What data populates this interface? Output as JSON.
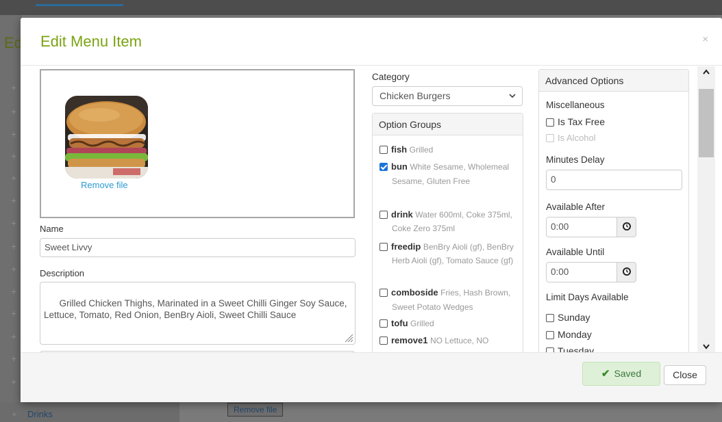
{
  "background": {
    "heading_fragment": "Ed",
    "sidebar_last_item": "Drinks",
    "remove_file_label": "Remove file"
  },
  "modal": {
    "title": "Edit Menu Item",
    "close_icon": "×",
    "image": {
      "alt": "Sweet Livvy burger photo",
      "remove_label": "Remove file"
    },
    "name_label": "Name",
    "name_value": "Sweet Livvy",
    "description_label": "Description",
    "description_value": "Grilled Chicken Thighs, Marinated in a Sweet Chilli Ginger Soy Sauce, Lettuce, Tomato, Red Onion, BenBry Aioli, Sweet Chilli Sauce",
    "category_label": "Category",
    "category_value": "Chicken Burgers",
    "option_groups": {
      "heading": "Option Groups",
      "items": [
        {
          "name": "fish",
          "details": "Grilled",
          "checked": false
        },
        {
          "name": "bun",
          "details": "White Sesame, Wholemeal Sesame, Gluten Free",
          "checked": true
        },
        {
          "name": "drink",
          "details": "Water 600ml, Coke 375ml, Coke Zero 375ml",
          "checked": false
        },
        {
          "name": "freedip",
          "details": "BenBry Aioli (gf), BenBry Herb Aioli (gf), Tomato Sauce (gf)",
          "checked": false
        },
        {
          "name": "comboside",
          "details": "Fries, Hash Brown, Sweet Potato Wedges",
          "checked": false
        },
        {
          "name": "tofu",
          "details": "Grilled",
          "checked": false
        },
        {
          "name": "remove1",
          "details": "NO Lettuce, NO",
          "checked": false
        }
      ]
    },
    "advanced": {
      "heading": "Advanced Options",
      "misc_label": "Miscellaneous",
      "tax_free_label": "Is Tax Free",
      "alcohol_label": "Is Alcohol",
      "minutes_delay_label": "Minutes Delay",
      "minutes_delay_value": "0",
      "available_after_label": "Available After",
      "available_after_value": "0:00",
      "available_until_label": "Available Until",
      "available_until_value": "0:00",
      "limit_days_label": "Limit Days Available",
      "days": [
        "Sunday",
        "Monday",
        "Tuesday"
      ]
    },
    "footer": {
      "saved_label": "Saved",
      "close_label": "Close"
    }
  },
  "colors": {
    "title": "#7aa311",
    "link": "#2a9bd0",
    "checkbox_checked": "#1a73d9",
    "saved_bg": "#dff0d8",
    "saved_text": "#3c763d"
  }
}
